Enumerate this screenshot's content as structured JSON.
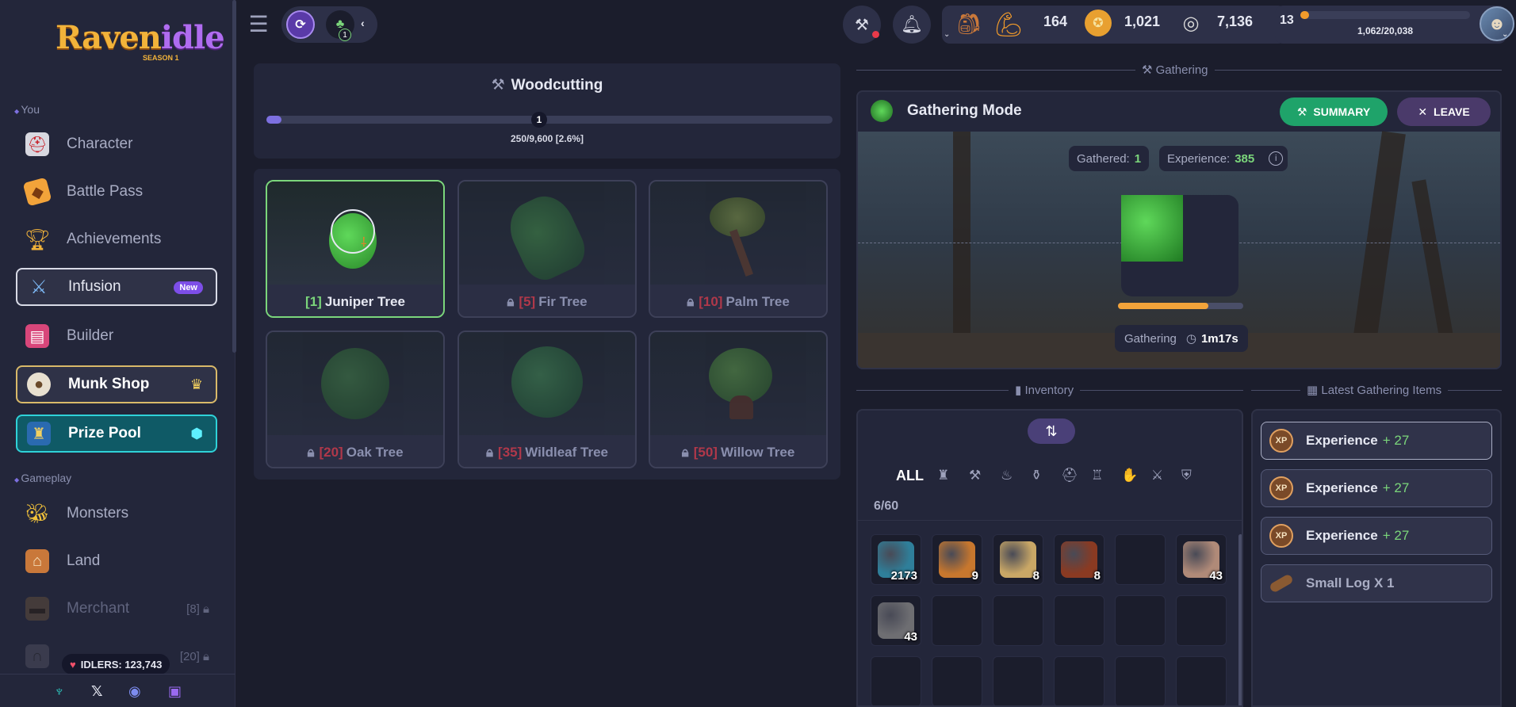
{
  "sidebar": {
    "logo": {
      "raven": "Raven",
      "idle": "idle",
      "season": "SEASON 1"
    },
    "sections": {
      "you": "You",
      "gameplay": "Gameplay"
    },
    "items": [
      {
        "label": "Character",
        "icon": "knight-helmet-icon"
      },
      {
        "label": "Battle Pass",
        "icon": "ticket-icon"
      },
      {
        "label": "Achievements",
        "icon": "trophy-icon"
      },
      {
        "label": "Infusion",
        "icon": "sword-icon",
        "badge": "New"
      },
      {
        "label": "Builder",
        "icon": "book-icon"
      },
      {
        "label": "Munk Shop",
        "icon": "munk-icon"
      },
      {
        "label": "Prize Pool",
        "icon": "prize-icon"
      },
      {
        "label": "Monsters",
        "icon": "bee-icon"
      },
      {
        "label": "Land",
        "icon": "house-icon"
      },
      {
        "label": "Merchant",
        "icon": "chest-icon",
        "lock_level": "[8]"
      },
      {
        "label": "",
        "icon": "gate-icon",
        "lock_level": "[20]"
      }
    ],
    "idlers": "IDLERS: 123,743"
  },
  "topbar": {
    "badge_count": "1",
    "stats": {
      "strength": "164",
      "gold": "1,021",
      "silver": "7,136"
    },
    "level": "13",
    "level_xp": "1,062/20,038",
    "level_progress": 0.053
  },
  "woodcutting": {
    "title": "Woodcutting",
    "level": "1",
    "xp_text": "250/9,600 [2.6%]",
    "progress_percent": 2.6,
    "trees": [
      {
        "level": "[1]",
        "name": "Juniper Tree",
        "locked": false,
        "color": "#3fae3a"
      },
      {
        "level": "[5]",
        "name": "Fir Tree",
        "locked": true,
        "color": "#2f7a3a"
      },
      {
        "level": "[10]",
        "name": "Palm Tree",
        "locked": true,
        "color": "#6c8a2e"
      },
      {
        "level": "[20]",
        "name": "Oak Tree",
        "locked": true,
        "color": "#2f6e2e"
      },
      {
        "level": "[35]",
        "name": "Wildleaf Tree",
        "locked": true,
        "color": "#2a6a36"
      },
      {
        "level": "[50]",
        "name": "Willow Tree",
        "locked": true,
        "color": "#3e7a2c"
      }
    ]
  },
  "gathering": {
    "section_label": "Gathering",
    "mode_title": "Gathering Mode",
    "summary_label": "SUMMARY",
    "leave_label": "LEAVE",
    "gathered_label": "Gathered:",
    "gathered_value": "1",
    "experience_label": "Experience:",
    "experience_value": "385",
    "status_label": "Gathering",
    "status_time": "1m17s",
    "progress": 0.72
  },
  "inventory": {
    "section_label": "Inventory",
    "filter_all": "ALL",
    "capacity": "6/60",
    "items": [
      {
        "count": "2173",
        "icon": "rune-stone-icon",
        "color": "#2f7f9a"
      },
      {
        "count": "9",
        "icon": "log-icon",
        "color": "#c7772e"
      },
      {
        "count": "8",
        "icon": "wheat-icon",
        "color": "#c9a766"
      },
      {
        "count": "8",
        "icon": "beans-icon",
        "color": "#8a3a22"
      },
      {
        "count": "",
        "icon": "",
        "color": ""
      },
      {
        "count": "43",
        "icon": "copper-ore-icon",
        "color": "#b08a78"
      },
      {
        "count": "43",
        "icon": "stone-icon",
        "color": "#6e6e72"
      }
    ]
  },
  "latest": {
    "section_label": "Latest Gathering Items",
    "rows": [
      {
        "label": "Experience",
        "amount": "+ 27"
      },
      {
        "label": "Experience",
        "amount": "+ 27"
      },
      {
        "label": "Experience",
        "amount": "+ 27"
      },
      {
        "label": "Small Log X 1",
        "amount": ""
      }
    ],
    "xp_icon_text": "XP"
  }
}
